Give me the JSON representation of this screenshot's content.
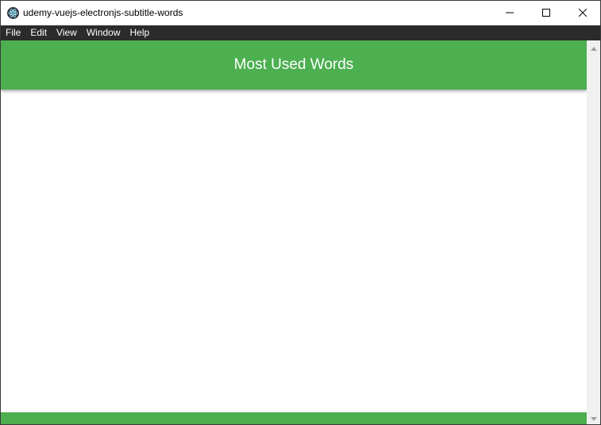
{
  "window": {
    "title": "udemy-vuejs-electronjs-subtitle-words",
    "app_icon": "electron-icon",
    "controls": [
      "minimize-icon",
      "maximize-icon",
      "close-icon"
    ]
  },
  "menubar": {
    "items": [
      {
        "label": "File"
      },
      {
        "label": "Edit"
      },
      {
        "label": "View"
      },
      {
        "label": "Window"
      },
      {
        "label": "Help"
      }
    ]
  },
  "header": {
    "title": "Most Used Words"
  },
  "colors": {
    "primary": "#4caf50",
    "menubar": "#2b2b2b",
    "header_text": "#ffffff"
  }
}
